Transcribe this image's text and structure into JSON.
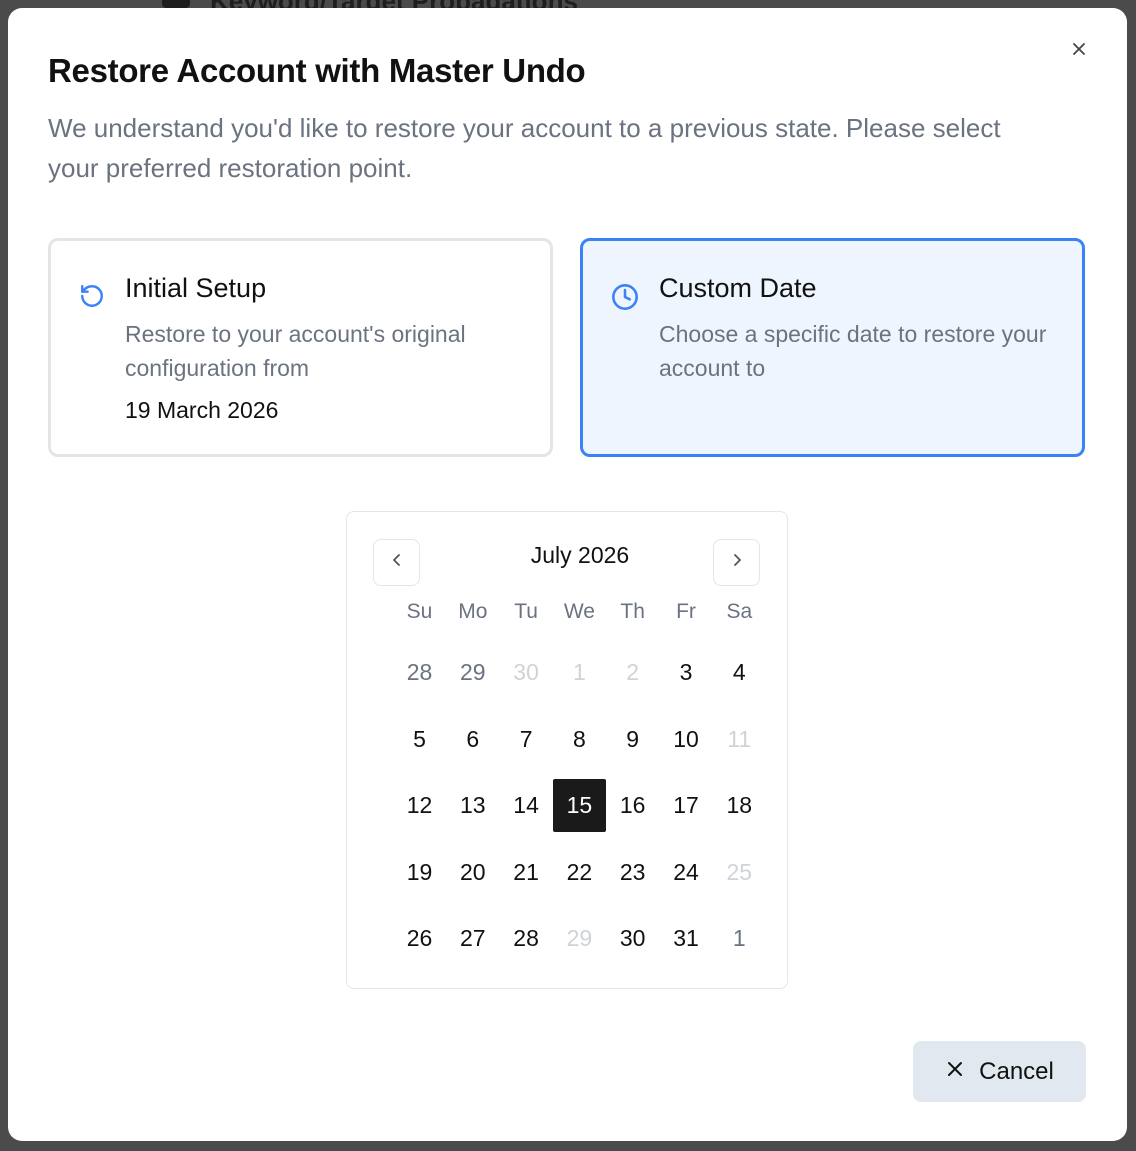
{
  "background": {
    "title": "Keyword/Target Propagations"
  },
  "dialog": {
    "title": "Restore Account with Master Undo",
    "subtitle": "We understand you'd like to restore your account to a previous state. Please select your preferred restoration point.",
    "close_icon": "close-icon"
  },
  "options": {
    "initial": {
      "title": "Initial Setup",
      "description": "Restore to your account's original configuration from",
      "date": "19 March 2026",
      "icon": "rotate-ccw-icon",
      "selected": false
    },
    "custom": {
      "title": "Custom Date",
      "description": "Choose a specific date to restore your account to",
      "icon": "clock-icon",
      "selected": true
    }
  },
  "calendar": {
    "month_label": "July 2026",
    "prev_icon": "chevron-left-icon",
    "next_icon": "chevron-right-icon",
    "weekdays": [
      "Su",
      "Mo",
      "Tu",
      "We",
      "Th",
      "Fr",
      "Sa"
    ],
    "weeks": [
      [
        {
          "d": "28",
          "s": "outside"
        },
        {
          "d": "29",
          "s": "outside"
        },
        {
          "d": "30",
          "s": "disabled"
        },
        {
          "d": "1",
          "s": "disabled"
        },
        {
          "d": "2",
          "s": "disabled"
        },
        {
          "d": "3",
          "s": "normal"
        },
        {
          "d": "4",
          "s": "normal"
        }
      ],
      [
        {
          "d": "5",
          "s": "normal"
        },
        {
          "d": "6",
          "s": "normal"
        },
        {
          "d": "7",
          "s": "normal"
        },
        {
          "d": "8",
          "s": "normal"
        },
        {
          "d": "9",
          "s": "normal"
        },
        {
          "d": "10",
          "s": "normal"
        },
        {
          "d": "11",
          "s": "disabled"
        }
      ],
      [
        {
          "d": "12",
          "s": "normal"
        },
        {
          "d": "13",
          "s": "normal"
        },
        {
          "d": "14",
          "s": "normal"
        },
        {
          "d": "15",
          "s": "selected"
        },
        {
          "d": "16",
          "s": "normal"
        },
        {
          "d": "17",
          "s": "normal"
        },
        {
          "d": "18",
          "s": "normal"
        }
      ],
      [
        {
          "d": "19",
          "s": "normal"
        },
        {
          "d": "20",
          "s": "normal"
        },
        {
          "d": "21",
          "s": "normal"
        },
        {
          "d": "22",
          "s": "normal"
        },
        {
          "d": "23",
          "s": "normal"
        },
        {
          "d": "24",
          "s": "normal"
        },
        {
          "d": "25",
          "s": "disabled"
        }
      ],
      [
        {
          "d": "26",
          "s": "normal"
        },
        {
          "d": "27",
          "s": "normal"
        },
        {
          "d": "28",
          "s": "normal"
        },
        {
          "d": "29",
          "s": "disabled"
        },
        {
          "d": "30",
          "s": "normal"
        },
        {
          "d": "31",
          "s": "normal"
        },
        {
          "d": "1",
          "s": "outside"
        }
      ]
    ],
    "selected_date": "15"
  },
  "footer": {
    "cancel_label": "Cancel",
    "cancel_icon": "x-icon"
  },
  "colors": {
    "accent": "#3b82f6",
    "accent_bg": "#eef5fe",
    "selected_day": "#1a1a1a",
    "cancel_bg": "#e2e8f0",
    "muted_text": "#6b7280"
  }
}
